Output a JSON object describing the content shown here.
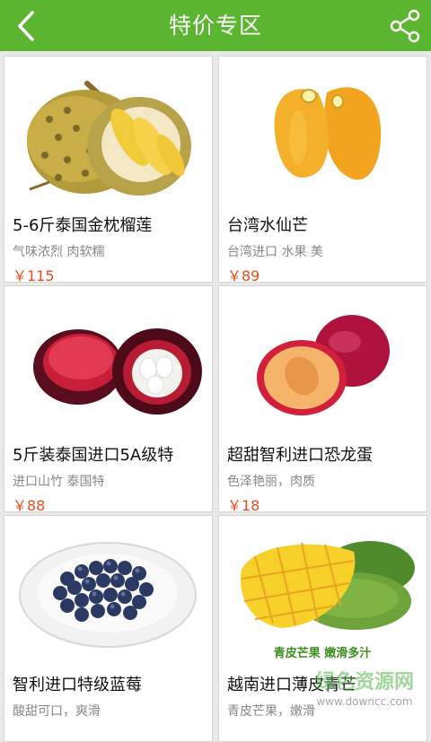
{
  "header": {
    "title": "特价专区",
    "back_icon": "chevron-left-icon",
    "share_icon": "share-icon",
    "bg_color": "#5cb531"
  },
  "products": [
    {
      "name": "5-6斤泰国金枕榴莲",
      "desc": "气味浓烈 肉软糯",
      "price": "￥115",
      "image": "durian"
    },
    {
      "name": "台湾水仙芒",
      "desc": "台湾进口 水果 美",
      "price": "￥89",
      "image": "mango-yellow"
    },
    {
      "name": "5斤装泰国进口5A级特",
      "desc": "进口山竹 泰国特",
      "price": "￥88",
      "image": "mangosteen"
    },
    {
      "name": "超甜智利进口恐龙蛋",
      "desc": "色泽艳丽，肉质",
      "price": "￥18",
      "image": "plum"
    },
    {
      "name": "智利进口特级蓝莓",
      "desc": "酸甜可口，爽滑",
      "price": "",
      "image": "blueberry"
    },
    {
      "name": "越南进口薄皮青芒",
      "desc": "青皮芒果，嫩滑",
      "price": "",
      "image": "green-mango"
    }
  ],
  "image_captions": {
    "green_mango": "青皮芒果  嫩滑多汁"
  },
  "watermark": {
    "text": "绿色资源网",
    "url": "www.downcc.com"
  },
  "price_color": "#e84d1c"
}
